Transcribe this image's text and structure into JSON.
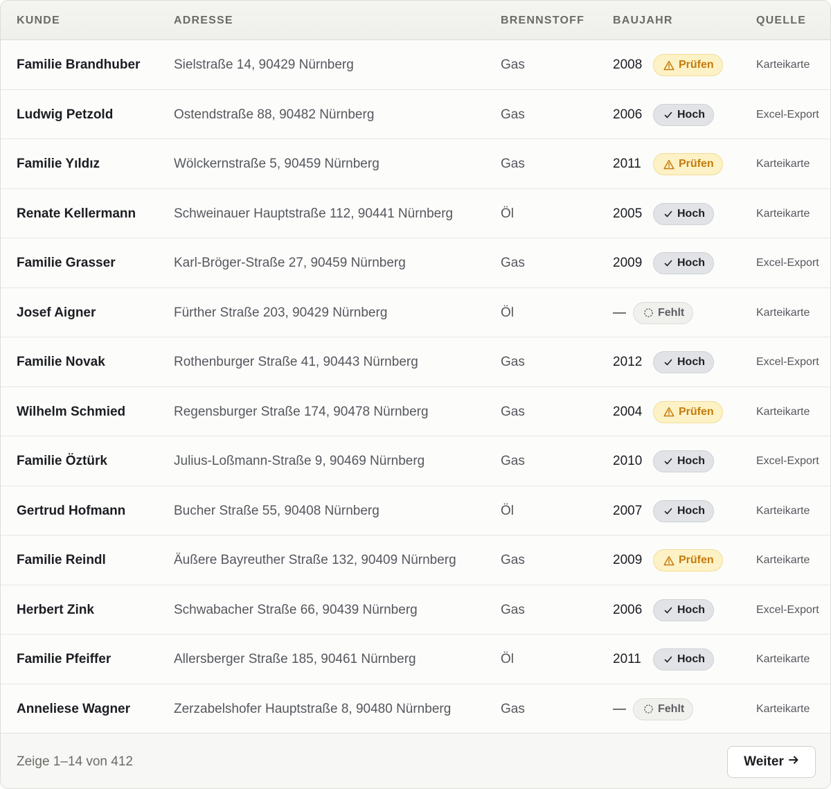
{
  "columns": {
    "kunde": "KUNDE",
    "adresse": "ADRESSE",
    "brennstoff": "BRENNSTOFF",
    "baujahr": "BAUJAHR",
    "quelle": "QUELLE"
  },
  "rows": [
    {
      "name": "Familie Brandhuber",
      "address": "Sielstraße 14, 90429 Nürnberg",
      "fuel": "Gas",
      "year": "2008",
      "status": "Prüfen",
      "status_type": "pruefen",
      "source": "Karteikarte"
    },
    {
      "name": "Ludwig Petzold",
      "address": "Ostendstraße 88, 90482 Nürnberg",
      "fuel": "Gas",
      "year": "2006",
      "status": "Hoch",
      "status_type": "hoch",
      "source": "Excel-Export"
    },
    {
      "name": "Familie Yıldız",
      "address": "Wölckernstraße 5, 90459 Nürnberg",
      "fuel": "Gas",
      "year": "2011",
      "status": "Prüfen",
      "status_type": "pruefen",
      "source": "Karteikarte"
    },
    {
      "name": "Renate Kellermann",
      "address": "Schweinauer Hauptstraße 112, 90441 Nürnberg",
      "fuel": "Öl",
      "year": "2005",
      "status": "Hoch",
      "status_type": "hoch",
      "source": "Karteikarte"
    },
    {
      "name": "Familie Grasser",
      "address": "Karl-Bröger-Straße 27, 90459 Nürnberg",
      "fuel": "Gas",
      "year": "2009",
      "status": "Hoch",
      "status_type": "hoch",
      "source": "Excel-Export"
    },
    {
      "name": "Josef Aigner",
      "address": "Fürther Straße 203, 90429 Nürnberg",
      "fuel": "Öl",
      "year": "—",
      "status": "Fehlt",
      "status_type": "fehlt",
      "source": "Karteikarte"
    },
    {
      "name": "Familie Novak",
      "address": "Rothenburger Straße 41, 90443 Nürnberg",
      "fuel": "Gas",
      "year": "2012",
      "status": "Hoch",
      "status_type": "hoch",
      "source": "Excel-Export"
    },
    {
      "name": "Wilhelm Schmied",
      "address": "Regensburger Straße 174, 90478 Nürnberg",
      "fuel": "Gas",
      "year": "2004",
      "status": "Prüfen",
      "status_type": "pruefen",
      "source": "Karteikarte"
    },
    {
      "name": "Familie Öztürk",
      "address": "Julius-Loßmann-Straße 9, 90469 Nürnberg",
      "fuel": "Gas",
      "year": "2010",
      "status": "Hoch",
      "status_type": "hoch",
      "source": "Excel-Export"
    },
    {
      "name": "Gertrud Hofmann",
      "address": "Bucher Straße 55, 90408 Nürnberg",
      "fuel": "Öl",
      "year": "2007",
      "status": "Hoch",
      "status_type": "hoch",
      "source": "Karteikarte"
    },
    {
      "name": "Familie Reindl",
      "address": "Äußere Bayreuther Straße 132, 90409 Nürnberg",
      "fuel": "Gas",
      "year": "2009",
      "status": "Prüfen",
      "status_type": "pruefen",
      "source": "Karteikarte"
    },
    {
      "name": "Herbert Zink",
      "address": "Schwabacher Straße 66, 90439 Nürnberg",
      "fuel": "Gas",
      "year": "2006",
      "status": "Hoch",
      "status_type": "hoch",
      "source": "Excel-Export"
    },
    {
      "name": "Familie Pfeiffer",
      "address": "Allersberger Straße 185, 90461 Nürnberg",
      "fuel": "Öl",
      "year": "2011",
      "status": "Hoch",
      "status_type": "hoch",
      "source": "Karteikarte"
    },
    {
      "name": "Anneliese Wagner",
      "address": "Zerzabelshofer Hauptstraße 8, 90480 Nürnberg",
      "fuel": "Gas",
      "year": "—",
      "status": "Fehlt",
      "status_type": "fehlt",
      "source": "Karteikarte"
    }
  ],
  "status_icons": {
    "hoch": "check-icon",
    "pruefen": "warning-triangle-icon",
    "fehlt": "dashed-circle-icon"
  },
  "colors": {
    "pruefen_bg": "#fdf2c6",
    "pruefen_text": "#c47a0c",
    "hoch_bg": "#e1e3e6",
    "fehlt_bg": "#f0f0ed"
  },
  "footer": {
    "summary": "Zeige 1–14 von 412",
    "next_label": "Weiter",
    "next_icon": "arrow-right-icon"
  }
}
